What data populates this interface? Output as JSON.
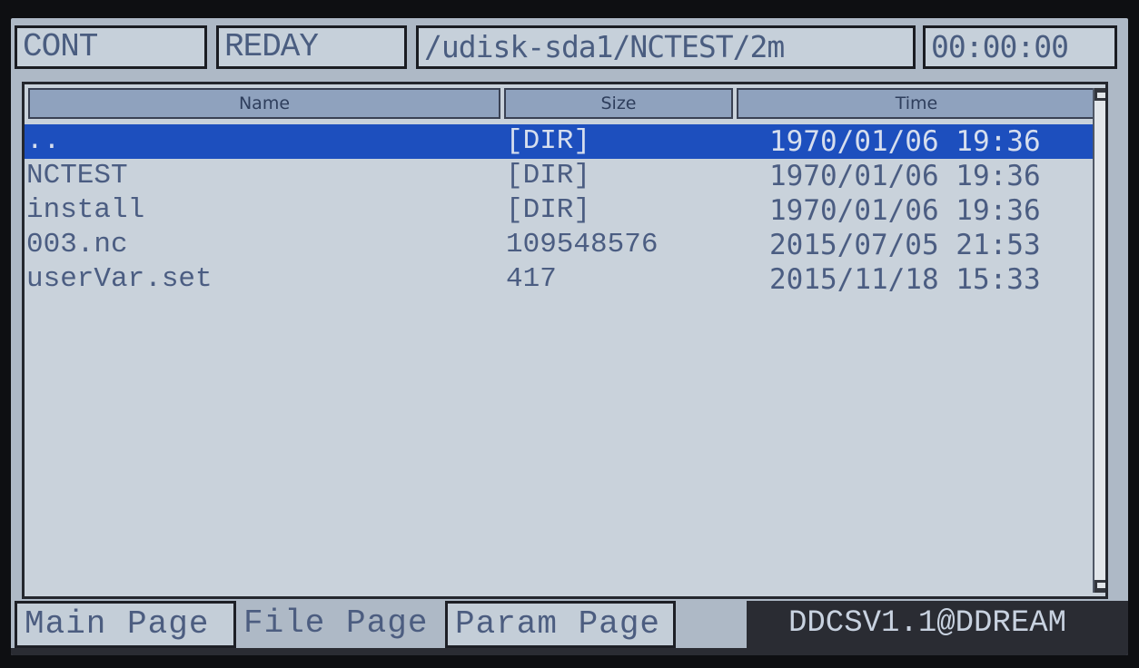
{
  "status_bar": {
    "mode": "CONT",
    "state": "REDAY",
    "path": "/udisk-sda1/NCTEST/2m",
    "time": "00:00:00"
  },
  "file_list": {
    "columns": [
      "Name",
      "Size",
      "Time"
    ],
    "rows": [
      {
        "name": "..",
        "size": "[DIR]",
        "time": "1970/01/06 19:36",
        "selected": true
      },
      {
        "name": "NCTEST",
        "size": "[DIR]",
        "time": "1970/01/06 19:36",
        "selected": false
      },
      {
        "name": "install",
        "size": "[DIR]",
        "time": "1970/01/06 19:36",
        "selected": false
      },
      {
        "name": "003.nc",
        "size": "109548576",
        "time": "2015/07/05 21:53",
        "selected": false
      },
      {
        "name": "userVar.set",
        "size": "417",
        "time": "2015/11/18 15:33",
        "selected": false
      }
    ]
  },
  "tabs": [
    "Main Page",
    "File Page",
    "Param Page"
  ],
  "active_tab": "File Page",
  "version": "DDCSV1.1@DDREAM",
  "colors": {
    "screen_bg": "#aeb9c6",
    "text": "#4b5d82",
    "selection": "#1d4fbe",
    "header_bg": "#8fa2be"
  }
}
